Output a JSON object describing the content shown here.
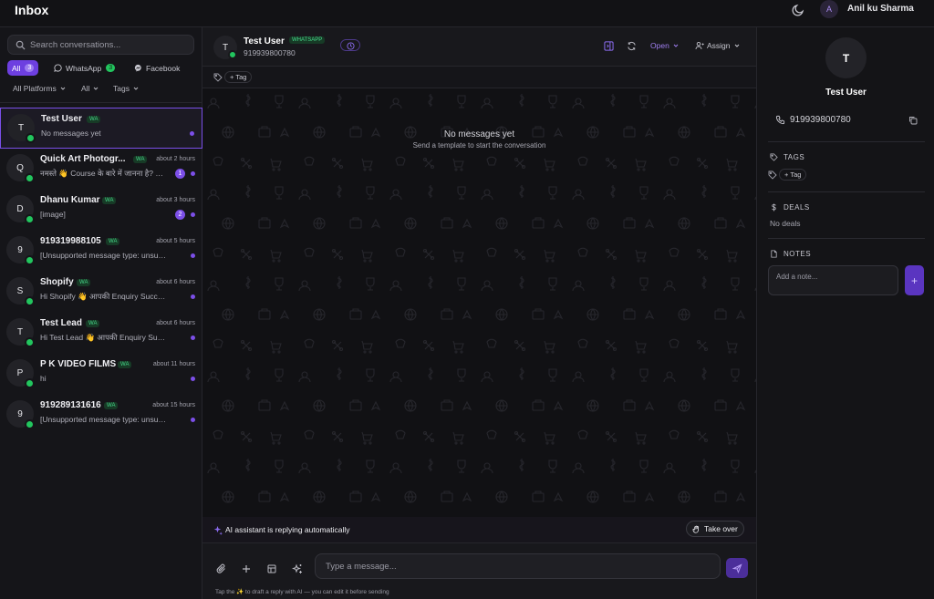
{
  "app": {
    "title": "Inbox",
    "user_initial": "A",
    "user_name": "Anil ku Sharma",
    "accent": "#7c4fe8",
    "whatsapp_green": "#22c55e"
  },
  "sidebar": {
    "search_placeholder": "Search conversations...",
    "filters": [
      {
        "label": "All",
        "count": "3",
        "active": true
      },
      {
        "label": "WhatsApp",
        "count": "3",
        "icon": "whatsapp-icon"
      },
      {
        "label": "Facebook",
        "icon": "messenger-icon"
      }
    ],
    "dropdowns": [
      "All Platforms",
      "All",
      "Tags"
    ],
    "conversations": [
      {
        "initial": "T",
        "name": "Test User",
        "platform": "WA",
        "time": "",
        "preview": "No messages yet",
        "unread": "",
        "selected": true
      },
      {
        "initial": "Q",
        "name": "Quick Art Photogr...",
        "platform": "WA",
        "time": "about 2 hours",
        "preview": "नमस्ते 👋 Course के बारे में जानना है? O...",
        "unread": "1"
      },
      {
        "initial": "D",
        "name": "Dhanu Kumar",
        "platform": "WA",
        "time": "about 3 hours",
        "preview": "[image]",
        "unread": "2"
      },
      {
        "initial": "9",
        "name": "919319988105",
        "platform": "WA",
        "time": "about 5 hours",
        "preview": "[Unsupported message type: unsupp...",
        "unread": ""
      },
      {
        "initial": "S",
        "name": "Shopify",
        "platform": "WA",
        "time": "about 6 hours",
        "preview": "Hi Shopify 👋 आपकी Enquiry Successf...",
        "unread": ""
      },
      {
        "initial": "T",
        "name": "Test Lead",
        "platform": "WA",
        "time": "about 6 hours",
        "preview": "Hi Test Lead 👋 आपकी Enquiry Succes...",
        "unread": ""
      },
      {
        "initial": "P",
        "name": "P K VIDEO FILMS",
        "platform": "WA",
        "time": "about 11 hours",
        "preview": "hi",
        "unread": ""
      },
      {
        "initial": "9",
        "name": "919289131616",
        "platform": "WA",
        "time": "about 15 hours",
        "preview": "[Unsupported message type: unsupp...",
        "unread": ""
      }
    ]
  },
  "chat": {
    "initial": "T",
    "name": "Test User",
    "platform": "WHATSAPP",
    "phone": "919939800780",
    "status": "Open",
    "assign": "Assign",
    "tag_button": "+ Tag",
    "empty_title": "No messages yet",
    "empty_sub": "Send a template to start the conversation",
    "ai_status": "AI assistant is replying automatically",
    "take_over": "Take over",
    "input_placeholder": "Type a message...",
    "hint": "Tap the ✨ to draft a reply with AI — you can edit it before sending"
  },
  "contact": {
    "initial": "T",
    "name": "Test User",
    "phone": "919939800780",
    "tags_label": "TAGS",
    "tag_button": "+ Tag",
    "deals_label": "DEALS",
    "deals_empty": "No deals",
    "notes_label": "NOTES",
    "note_placeholder": "Add a note...",
    "note_add": "+"
  }
}
